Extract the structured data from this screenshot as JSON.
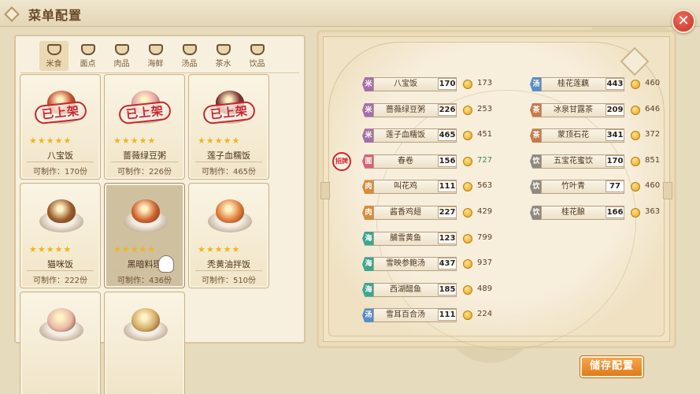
{
  "header": {
    "title": "菜单配置",
    "close_label": "✕"
  },
  "tabs": [
    {
      "label": "米食",
      "icon": "rice-bowl-icon",
      "active": true
    },
    {
      "label": "面点",
      "icon": "noodle-bowl-icon"
    },
    {
      "label": "肉品",
      "icon": "meat-icon"
    },
    {
      "label": "海鲜",
      "icon": "shrimp-icon"
    },
    {
      "label": "汤品",
      "icon": "soup-pot-icon"
    },
    {
      "label": "茶水",
      "icon": "teapot-icon"
    },
    {
      "label": "饮品",
      "icon": "drink-cup-icon"
    }
  ],
  "dishes": [
    {
      "name": "八宝饭",
      "count": "可制作：170份",
      "stamp": "已上架",
      "stars": "★★★★★",
      "food_color": "#c0502f"
    },
    {
      "name": "蔷薇绿豆粥",
      "count": "可制作：226份",
      "stamp": "已上架",
      "stars": "★★★★★",
      "food_color": "#e4a1a3"
    },
    {
      "name": "莲子血糯饭",
      "count": "可制作：465份",
      "stamp": "已上架",
      "stars": "★★★★★",
      "food_color": "#7a2e2c"
    },
    {
      "name": "猫咪饭",
      "count": "可制作：222份",
      "stamp": "",
      "stars": "★★★★★",
      "food_color": "#9b5b2c"
    },
    {
      "name": "黑暗料理",
      "count": "可制作：436份",
      "stamp": "",
      "stars": "★★★★★",
      "food_color": "#d0622f"
    },
    {
      "name": "秃黄油拌饭",
      "count": "可制作：510份",
      "stamp": "",
      "stars": "★★★★★",
      "food_color": "#e07d3a"
    },
    {
      "name": "",
      "count": "",
      "stamp": "",
      "stars": "",
      "food_color": "#e9b9a7"
    },
    {
      "name": "",
      "count": "",
      "stamp": "",
      "stars": "",
      "food_color": "#d4ad66"
    }
  ],
  "menu_left": [
    {
      "cat": "米",
      "cat_color": "#a46fa6",
      "name": "八宝饭",
      "qty": "170",
      "price": "173",
      "green": false
    },
    {
      "cat": "米",
      "cat_color": "#a46fa6",
      "name": "蔷薇绿豆粥",
      "qty": "226",
      "price": "253",
      "green": false
    },
    {
      "cat": "米",
      "cat_color": "#a46fa6",
      "name": "莲子血糯饭",
      "qty": "465",
      "price": "451",
      "green": false
    },
    {
      "cat": "面",
      "cat_color": "#d36476",
      "name": "春卷",
      "qty": "156",
      "price": "727",
      "green": true
    },
    {
      "cat": "肉",
      "cat_color": "#d98c3c",
      "name": "叫花鸡",
      "qty": "111",
      "price": "563",
      "green": false
    },
    {
      "cat": "肉",
      "cat_color": "#d98c3c",
      "name": "酱香鸡翅",
      "qty": "227",
      "price": "429",
      "green": false
    },
    {
      "cat": "海",
      "cat_color": "#3fa591",
      "name": "脯雪黄鱼",
      "qty": "123",
      "price": "799",
      "green": false
    },
    {
      "cat": "海",
      "cat_color": "#3fa591",
      "name": "雪映参鲍汤",
      "qty": "437",
      "price": "937",
      "green": false
    },
    {
      "cat": "海",
      "cat_color": "#3fa591",
      "name": "西湖醋鱼",
      "qty": "185",
      "price": "489",
      "green": false
    },
    {
      "cat": "汤",
      "cat_color": "#5a8dc7",
      "name": "雪耳百合汤",
      "qty": "111",
      "price": "224",
      "green": false
    }
  ],
  "menu_right": [
    {
      "cat": "汤",
      "cat_color": "#5a8dc7",
      "name": "桂花莲藕",
      "qty": "443",
      "price": "460"
    },
    {
      "cat": "茶",
      "cat_color": "#c57a4d",
      "name": "冰泉甘露茶",
      "qty": "209",
      "price": "646"
    },
    {
      "cat": "茶",
      "cat_color": "#c57a4d",
      "name": "蒙顶石花",
      "qty": "341",
      "price": "372"
    },
    {
      "cat": "饮",
      "cat_color": "#8f8a80",
      "name": "五宝花蜜饮",
      "qty": "170",
      "price": "851"
    },
    {
      "cat": "饮",
      "cat_color": "#8f8a80",
      "name": "竹叶青",
      "qty": "77",
      "price": "460"
    },
    {
      "cat": "饮",
      "cat_color": "#8f8a80",
      "name": "桂花酿",
      "qty": "166",
      "price": "363"
    }
  ],
  "featured_mark": "招牌",
  "save_button": "储存配置"
}
